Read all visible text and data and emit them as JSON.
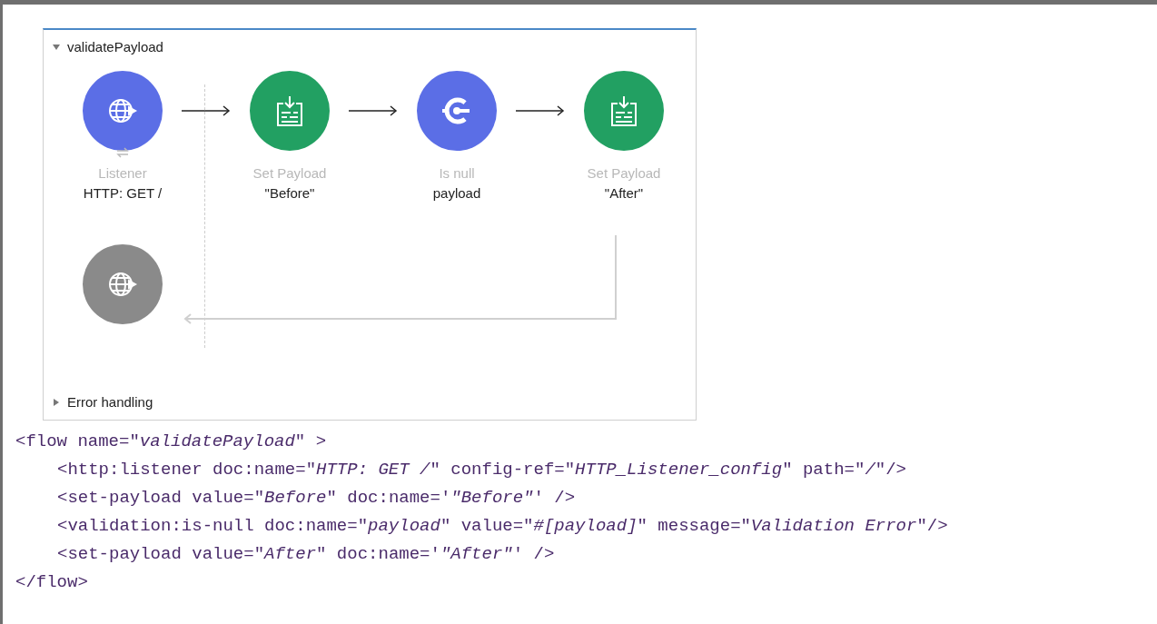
{
  "flow": {
    "title": "validatePayload",
    "expanded": true,
    "nodes": [
      {
        "kind": "listener",
        "type_label": "Listener",
        "name": "HTTP: GET /"
      },
      {
        "kind": "set-payload",
        "type_label": "Set Payload",
        "name": "\"Before\""
      },
      {
        "kind": "validator",
        "type_label": "Is null",
        "name": "payload"
      },
      {
        "kind": "set-payload",
        "type_label": "Set Payload",
        "name": "\"After\""
      }
    ],
    "error_handling": {
      "label": "Error handling",
      "expanded": false
    }
  },
  "code": {
    "open": "<flow name=\"*validatePayload*\" >",
    "children": [
      "<http:listener doc:name=\"*HTTP: GET /*\" config-ref=\"*HTTP_Listener_config*\" path=\"*/*\"/>",
      "<set-payload value=\"*Before*\" doc:name='*\"Before\"*' />",
      "<validation:is-null doc:name=\"*payload*\" value=\"*#[payload]*\" message=\"*Validation Error*\"/>",
      "<set-payload value=\"*After*\" doc:name='*\"After\"*' />"
    ],
    "close": "</flow>"
  }
}
